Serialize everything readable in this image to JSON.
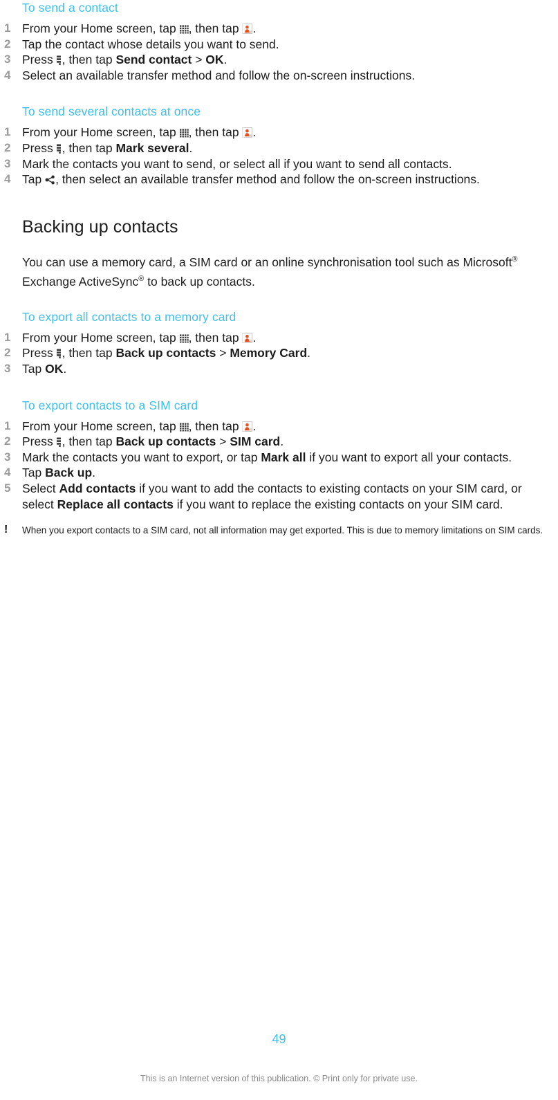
{
  "page": {
    "number": "49",
    "footer_note": "This is an Internet version of this publication. © Print only for private use."
  },
  "icons": {
    "grid": "app-drawer-grid-icon",
    "contacts": "contacts-person-icon",
    "menu": "options-menu-key-icon",
    "share": "share-icon",
    "note": "!"
  },
  "sections": {
    "send_contact": {
      "heading": "To send a contact",
      "steps": {
        "s1_a": "From your Home screen, tap ",
        "s1_b": ", then tap ",
        "s1_c": ".",
        "s2": "Tap the contact whose details you want to send.",
        "s3_a": "Press ",
        "s3_b": ", then tap ",
        "s3_bold1": "Send contact",
        "s3_sep": " > ",
        "s3_bold2": "OK",
        "s3_end": ".",
        "s4": "Select an available transfer method and follow the on-screen instructions."
      }
    },
    "send_several": {
      "heading": "To send several contacts at once",
      "steps": {
        "s1_a": "From your Home screen, tap ",
        "s1_b": ", then tap ",
        "s1_c": ".",
        "s2_a": "Press ",
        "s2_b": ", then tap ",
        "s2_bold": "Mark several",
        "s2_end": ".",
        "s3": "Mark the contacts you want to send, or select all if you want to send all contacts.",
        "s4_a": "Tap ",
        "s4_b": ", then select an available transfer method and follow the on-screen instructions."
      }
    },
    "backing_up": {
      "heading": "Backing up contacts",
      "para_a": "You can use a memory card, a SIM card or an online synchronisation tool such as Microsoft",
      "para_sup1": "®",
      "para_b": " Exchange ActiveSync",
      "para_sup2": "®",
      "para_c": " to back up contacts."
    },
    "export_memory_card": {
      "heading": "To export all contacts to a memory card",
      "steps": {
        "s1_a": "From your Home screen, tap ",
        "s1_b": ", then tap ",
        "s1_c": ".",
        "s2_a": "Press ",
        "s2_b": ", then tap ",
        "s2_bold1": "Back up contacts",
        "s2_sep": " > ",
        "s2_bold2": "Memory Card",
        "s2_end": ".",
        "s3_a": "Tap ",
        "s3_bold": "OK",
        "s3_end": "."
      }
    },
    "export_sim_card": {
      "heading": "To export contacts to a SIM card",
      "steps": {
        "s1_a": "From your Home screen, tap ",
        "s1_b": ", then tap ",
        "s1_c": ".",
        "s2_a": "Press ",
        "s2_b": ", then tap ",
        "s2_bold1": "Back up contacts",
        "s2_sep": " > ",
        "s2_bold2": "SIM card",
        "s2_end": ".",
        "s3_a": "Mark the contacts you want to export, or tap ",
        "s3_bold": "Mark all",
        "s3_b": " if you want to export all your contacts.",
        "s4_a": "Tap ",
        "s4_bold": "Back up",
        "s4_end": ".",
        "s5_a": "Select ",
        "s5_bold1": "Add contacts",
        "s5_b": " if you want to add the contacts to existing contacts on your SIM card, or select ",
        "s5_bold2": "Replace all contacts",
        "s5_c": " if you want to replace the existing contacts on your SIM card."
      }
    },
    "note": {
      "text": "When you export contacts to a SIM card, not all information may get exported. This is due to memory limitations on SIM cards."
    }
  },
  "colors": {
    "heading_blue": "#41bfe8",
    "body_text": "#1c1c1c",
    "step_number": "#9b9b9b",
    "footer_gray": "#8a8a8a",
    "contacts_icon_orange": "#e8511e"
  }
}
